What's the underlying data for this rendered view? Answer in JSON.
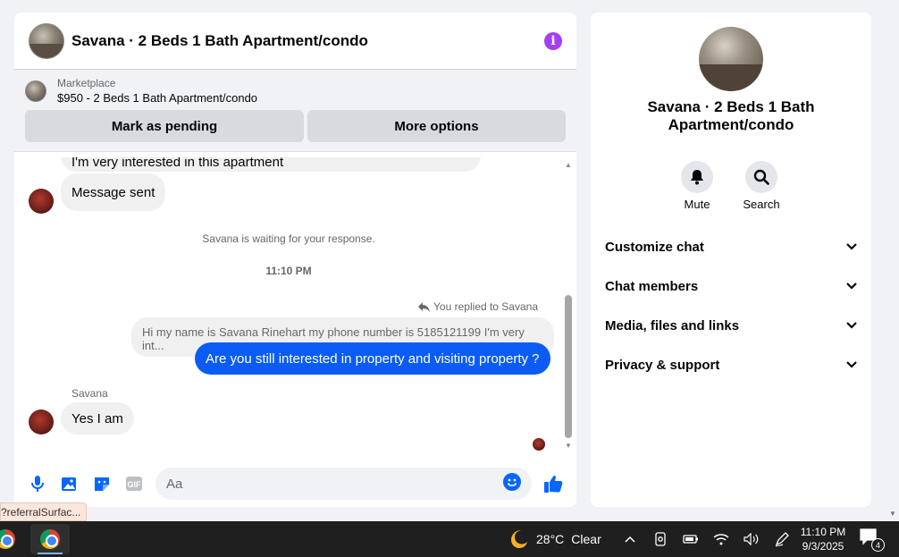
{
  "chat": {
    "title": "Savana · 2 Beds 1 Bath Apartment/condo",
    "marketplace_label": "Marketplace",
    "listing": "$950 - 2 Beds 1 Bath Apartment/condo",
    "mark_pending": "Mark as pending",
    "more_options": "More options"
  },
  "messages": {
    "partial_top": "I'm very interested in this apartment",
    "message_sent": "Message sent",
    "waiting": "Savana is waiting for your response.",
    "time": "11:10 PM",
    "replied_to": "You replied to Savana",
    "quoted": "Hi my name is Savana Rinehart my phone number is 5185121199 I'm very int...",
    "outgoing": "Are you still interested in property and visiting property ?",
    "sender": "Savana",
    "reply": "Yes I am"
  },
  "composer": {
    "placeholder": "Aa"
  },
  "info_panel": {
    "name": "Savana · 2 Beds 1 Bath Apartment/condo",
    "mute": "Mute",
    "search": "Search",
    "sections": [
      "Customize chat",
      "Chat members",
      "Media, files and links",
      "Privacy & support"
    ]
  },
  "status_tip": "?referralSurfac...",
  "taskbar": {
    "temperature": "28°C",
    "weather": "Clear",
    "time": "11:10 PM",
    "date": "9/3/2025",
    "notif_count": "4"
  },
  "colors": {
    "accent_blue": "#0a5cf5",
    "info_purple": "#a33ff5",
    "like_blue": "#0866ff"
  }
}
